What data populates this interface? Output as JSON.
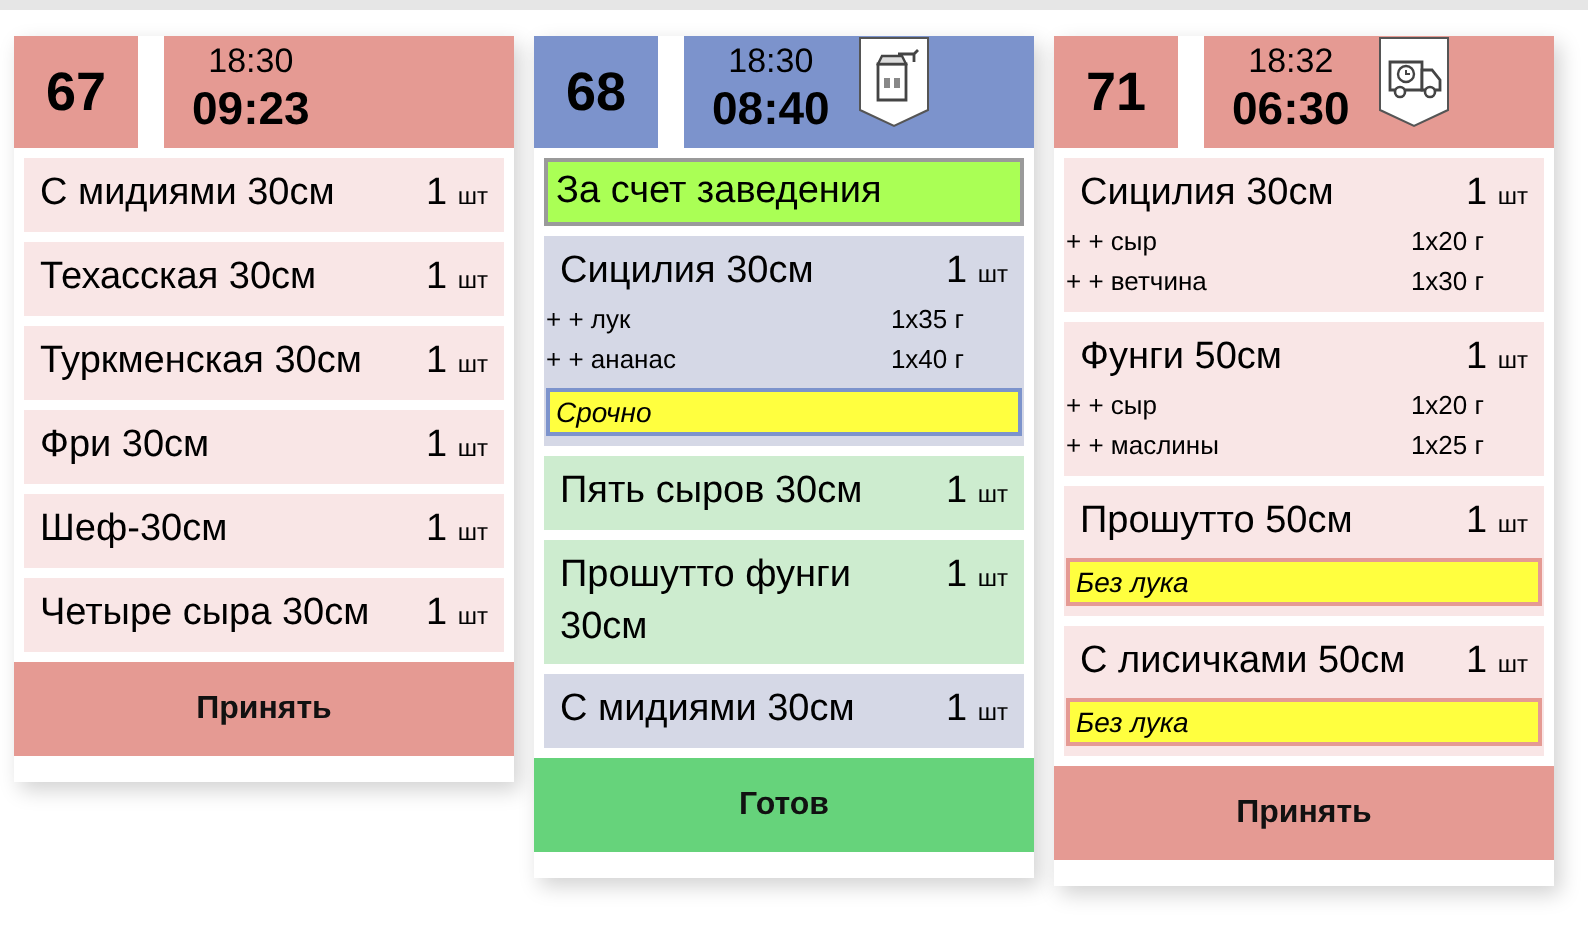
{
  "orders": [
    {
      "number": "67",
      "color": "#e59a93",
      "time": "18:30",
      "elapsed": "09:23",
      "items": [
        {
          "name": "С мидиями 30см",
          "qty": "1",
          "unit": "шт",
          "color": "#f9e6e6"
        },
        {
          "name": "Техасская 30см",
          "qty": "1",
          "unit": "шт",
          "color": "#f9e6e6"
        },
        {
          "name": "Туркменская 30см",
          "qty": "1",
          "unit": "шт",
          "color": "#f9e6e6"
        },
        {
          "name": "Фри 30см",
          "qty": "1",
          "unit": "шт",
          "color": "#f9e6e6"
        },
        {
          "name": "Шеф-30см",
          "qty": "1",
          "unit": "шт",
          "color": "#f9e6e6"
        },
        {
          "name": "Четыре сыра 30см",
          "qty": "1",
          "unit": "шт",
          "color": "#f9e6e6"
        }
      ],
      "button": {
        "label": "Принять",
        "kind": "accept"
      }
    },
    {
      "number": "68",
      "color": "#7c93cc",
      "time": "18:30",
      "elapsed": "08:40",
      "kind": "takeaway",
      "banner": "За счет заведения",
      "items": [
        {
          "name": "Сицилия 30см",
          "qty": "1",
          "unit": "шт",
          "color": "#d5d8e6",
          "modifiers": [
            {
              "name": "+ + лук",
              "amount": "1x35 г"
            },
            {
              "name": "+ + ананас",
              "amount": "1x40 г"
            }
          ],
          "note": "Срочно"
        },
        {
          "name": "Пять сыров 30см",
          "qty": "1",
          "unit": "шт",
          "color": "#cdeccf"
        },
        {
          "name": "Прошутто фунги 30см",
          "qty": "1",
          "unit": "шт",
          "color": "#cdeccf"
        },
        {
          "name": "С мидиями 30см",
          "qty": "1",
          "unit": "шт",
          "color": "#d5d8e6"
        }
      ],
      "button": {
        "label": "Готов",
        "kind": "ready"
      }
    },
    {
      "number": "71",
      "color": "#e59a93",
      "time": "18:32",
      "elapsed": "06:30",
      "kind": "delivery",
      "items": [
        {
          "name": "Сицилия 30см",
          "qty": "1",
          "unit": "шт",
          "color": "#f9e6e6",
          "modifiers": [
            {
              "name": "+ + сыр",
              "amount": "1x20 г"
            },
            {
              "name": "+ + ветчина",
              "amount": "1x30 г"
            }
          ]
        },
        {
          "name": "Фунги 50см",
          "qty": "1",
          "unit": "шт",
          "color": "#f9e6e6",
          "modifiers": [
            {
              "name": "+ + сыр",
              "amount": "1x20 г"
            },
            {
              "name": "+ + маслины",
              "amount": "1x25 г"
            }
          ]
        },
        {
          "name": "Прошутто 50см",
          "qty": "1",
          "unit": "шт",
          "color": "#f9e6e6",
          "note": "Без лука"
        },
        {
          "name": "С лисичками 50см",
          "qty": "1",
          "unit": "шт",
          "color": "#f9e6e6",
          "note": "Без лука"
        }
      ],
      "button": {
        "label": "Принять",
        "kind": "accept"
      }
    }
  ]
}
